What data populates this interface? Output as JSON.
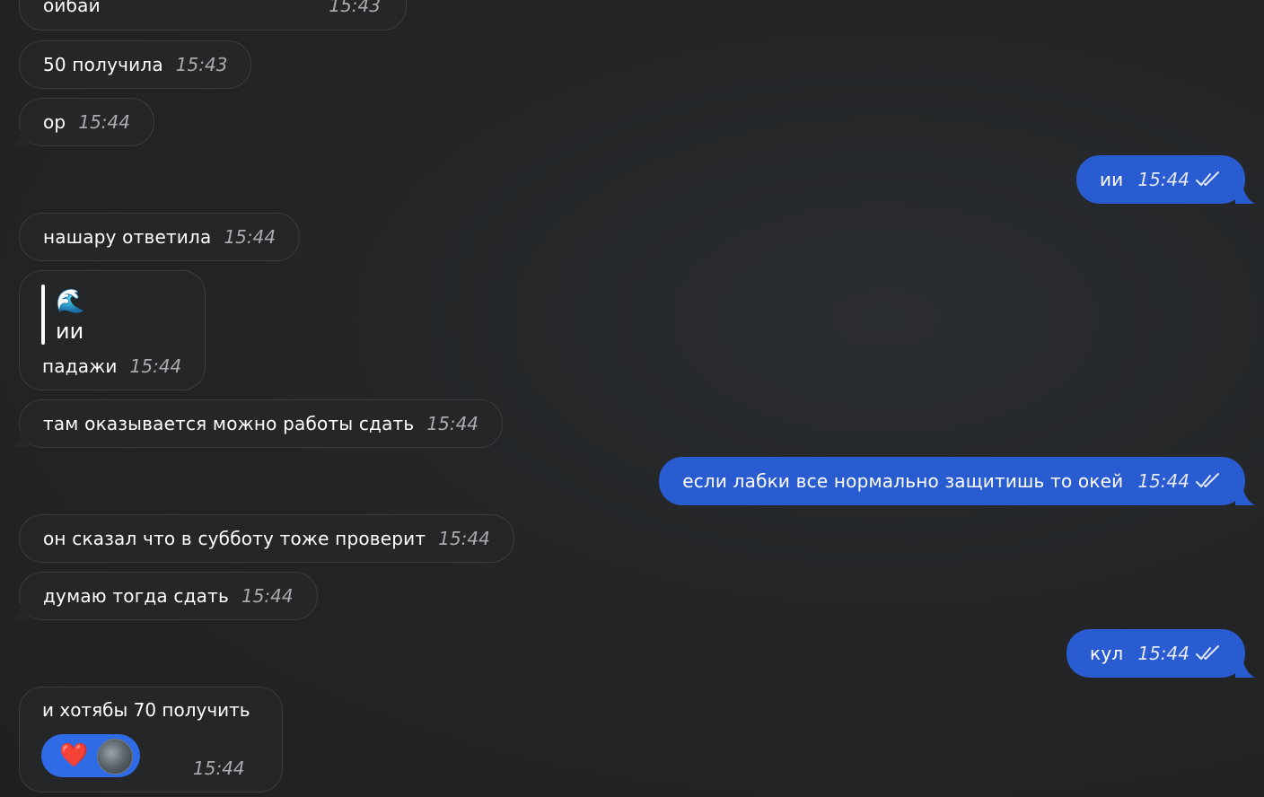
{
  "messages": [
    {
      "id": "m1",
      "dir": "in",
      "text": "ойбай",
      "time": "15:43"
    },
    {
      "id": "m2",
      "dir": "in",
      "text": "50 получила",
      "time": "15:43"
    },
    {
      "id": "m3",
      "dir": "in",
      "text": "ор",
      "time": "15:44"
    },
    {
      "id": "m4",
      "dir": "out",
      "text": "ии",
      "time": "15:44"
    },
    {
      "id": "m5",
      "dir": "in",
      "text": "нашару ответила",
      "time": "15:44"
    },
    {
      "id": "m6",
      "dir": "in",
      "reply": {
        "emoji": "🌊",
        "text": "ии"
      },
      "text": "падажи",
      "time": "15:44"
    },
    {
      "id": "m7",
      "dir": "in",
      "text": "там оказывается можно работы сдать",
      "time": "15:44"
    },
    {
      "id": "m8",
      "dir": "out",
      "text": "если лабки все нормально защитишь то окей",
      "time": "15:44"
    },
    {
      "id": "m9",
      "dir": "in",
      "text": "он сказал что в субботу тоже проверит",
      "time": "15:44"
    },
    {
      "id": "m10",
      "dir": "in",
      "text": "думаю тогда сдать",
      "time": "15:44"
    },
    {
      "id": "m11",
      "dir": "out",
      "text": "кул",
      "time": "15:44"
    },
    {
      "id": "m12",
      "dir": "in",
      "text": "и хотябы 70 получить",
      "time": "15:44",
      "reaction": "❤️"
    }
  ],
  "colors": {
    "incoming_bg": "#252628",
    "outgoing_bg": "#2a5cd1",
    "reaction_bg": "#2f6be7"
  }
}
